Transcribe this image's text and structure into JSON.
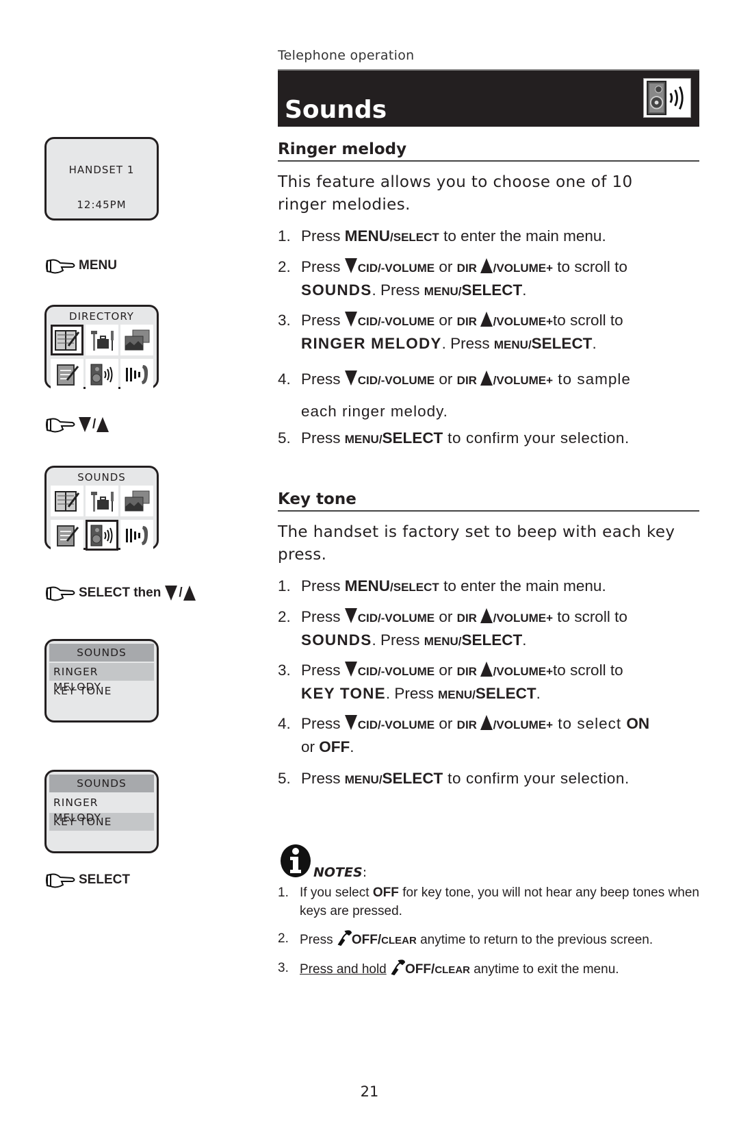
{
  "header": {
    "section": "Telephone operation",
    "title": "Sounds",
    "title_icon": "speaker-sound-icon"
  },
  "ringer_melody": {
    "heading": "Ringer melody",
    "intro": "This feature allows you to choose one of 10 ringer melodies.",
    "steps": [
      {
        "num": "1.",
        "parts": {
          "a": "Press ",
          "b": "MENU",
          "c": "/SELECT",
          "d": " to enter the main menu."
        }
      },
      {
        "num": "2.",
        "parts": {
          "a": "Press ",
          "down": "CID/-VOLUME",
          "or": " or ",
          "dir": "DIR ",
          "up": "/VOLUME+",
          "e": " to scroll to",
          "target": "SOUNDS",
          "f": ". Press ",
          "g": "MENU/",
          "h": "SELECT",
          "i": "."
        }
      },
      {
        "num": "3.",
        "parts": {
          "a": "Press ",
          "down": "CID/-VOLUME",
          "or": " or ",
          "dir": "DIR ",
          "up": "/VOLUME+",
          "e": "to scroll to",
          "target": "RINGER MELODY",
          "f": ". Press ",
          "g": "MENU/",
          "h": "SELECT",
          "i": "."
        }
      },
      {
        "num": "4.",
        "parts": {
          "a": "Press ",
          "down": "CID/-VOLUME",
          "or": " or ",
          "dir": "DIR ",
          "up": "/VOLUME+",
          "e": " to sample",
          "cont": "each ringer melody."
        }
      },
      {
        "num": "5.",
        "parts": {
          "a": "Press ",
          "g": "MENU/",
          "h": "SELECT",
          "e": " to confirm your selection."
        }
      }
    ]
  },
  "key_tone": {
    "heading": "Key tone",
    "intro": "The handset is factory set to beep with each key press.",
    "steps": [
      {
        "num": "1.",
        "parts": {
          "a": "Press ",
          "b": "MENU",
          "c": "/SELECT",
          "d": " to enter the main menu."
        }
      },
      {
        "num": "2.",
        "parts": {
          "a": "Press ",
          "down": "CID/-VOLUME",
          "or": " or ",
          "dir": "DIR ",
          "up": "/VOLUME+",
          "e": " to scroll to",
          "target": "SOUNDS",
          "f": ". Press ",
          "g": "MENU/",
          "h": "SELECT",
          "i": "."
        }
      },
      {
        "num": "3.",
        "parts": {
          "a": "Press ",
          "down": "CID/-VOLUME",
          "or": " or ",
          "dir": "DIR ",
          "up": "/VOLUME+",
          "e": "to scroll to",
          "target": "KEY TONE",
          "f": ". Press ",
          "g": "MENU/",
          "h": "SELECT",
          "i": "."
        }
      },
      {
        "num": "4.",
        "parts": {
          "a": "Press ",
          "down": "CID/-VOLUME",
          "or": " or ",
          "dir": "DIR ",
          "up": "/VOLUME+",
          "e": " to select ",
          "on": "ON",
          "or2": "or ",
          "off": "OFF",
          "i": "."
        }
      },
      {
        "num": "5.",
        "parts": {
          "a": "Press ",
          "g": "MENU/",
          "h": "SELECT",
          "e": " to confirm your selection."
        }
      }
    ]
  },
  "notes": {
    "label": "NOTES",
    "colon": ":",
    "items": [
      {
        "num": "1.",
        "a": "If you select ",
        "b": "OFF",
        "c": " for key tone, you will not hear any beep tones when keys are pressed."
      },
      {
        "num": "2.",
        "a": "Press ",
        "b": "OFF/",
        "c": "CLEAR",
        "d": " anytime to return to the previous screen."
      },
      {
        "num": "3.",
        "u": "Press and hold",
        "b": "OFF/",
        "c": "CLEAR",
        "d": " anytime to exit the menu."
      }
    ]
  },
  "sidebar": {
    "idle_screen": {
      "line1": "HANDSET 1",
      "line2": "12:45PM"
    },
    "cmd1": "MENU",
    "menu_screen_1": {
      "title": "DIRECTORY",
      "selected_index": 0
    },
    "cmd2_slash": "/",
    "menu_screen_2": {
      "title": "SOUNDS",
      "selected_index": 4
    },
    "cmd3": "SELECT then",
    "cmd3_slash": "/",
    "list_screen_1": {
      "header": "SOUNDS",
      "items": [
        "RINGER MELODY",
        "KEY TONE"
      ],
      "selected": "RINGER MELODY"
    },
    "list_screen_2": {
      "header": "SOUNDS",
      "items": [
        "RINGER MELODY",
        "KEY TONE"
      ],
      "selected": "KEY TONE"
    },
    "cmd4": "SELECT"
  },
  "page_number": "21"
}
